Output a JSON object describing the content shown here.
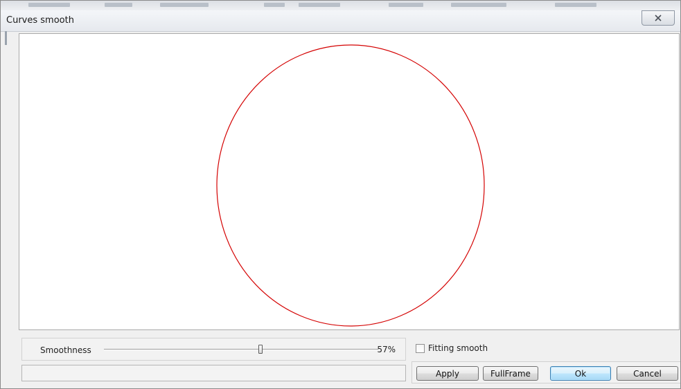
{
  "window": {
    "title": "Curves smooth"
  },
  "icons": {
    "close": "close-icon"
  },
  "canvas": {
    "curve_color": "#d40000",
    "background": "#ffffff"
  },
  "smoothness": {
    "label": "Smoothness",
    "value": 57,
    "value_text": "57%"
  },
  "fitting": {
    "label": "Fitting smooth",
    "checked": false
  },
  "status": {
    "text": ""
  },
  "buttons": {
    "apply": "Apply",
    "fullframe": "FullFrame",
    "ok": "Ok",
    "cancel": "Cancel"
  }
}
